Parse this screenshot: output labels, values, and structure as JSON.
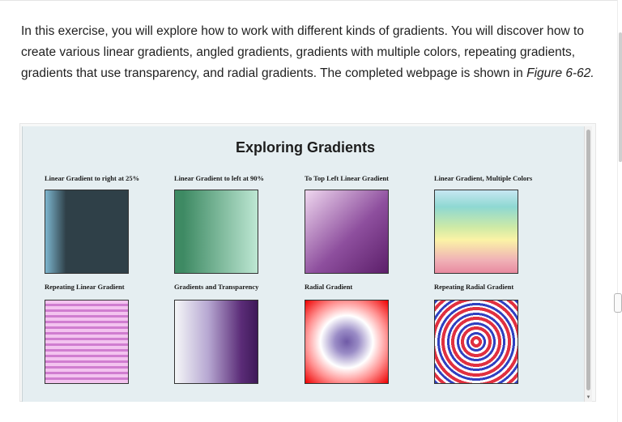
{
  "intro": {
    "text": "In this exercise, you will explore how to work with different kinds of gradients. You will discover how to create various linear gradients, angled gradients, gradients with multiple colors, repeating gradients, gradients that use transparency, and radial gradients. The completed webpage is shown in ",
    "figure_ref": "Figure 6-62.",
    "trailing": ""
  },
  "screenshot": {
    "title": "Exploring Gradients",
    "background_color": "#e5eef1",
    "cells": [
      {
        "label": "Linear Gradient to right at 25%"
      },
      {
        "label": "Linear Gradient to left at 90%"
      },
      {
        "label": "To Top Left Linear Gradient"
      },
      {
        "label": "Linear Gradient, Multiple Colors"
      },
      {
        "label": "Repeating Linear Gradient"
      },
      {
        "label": "Gradients and Transparency"
      },
      {
        "label": "Radial Gradient"
      },
      {
        "label": "Repeating Radial Gradient"
      }
    ]
  },
  "scrollbar": {
    "down_arrow": "▾"
  }
}
